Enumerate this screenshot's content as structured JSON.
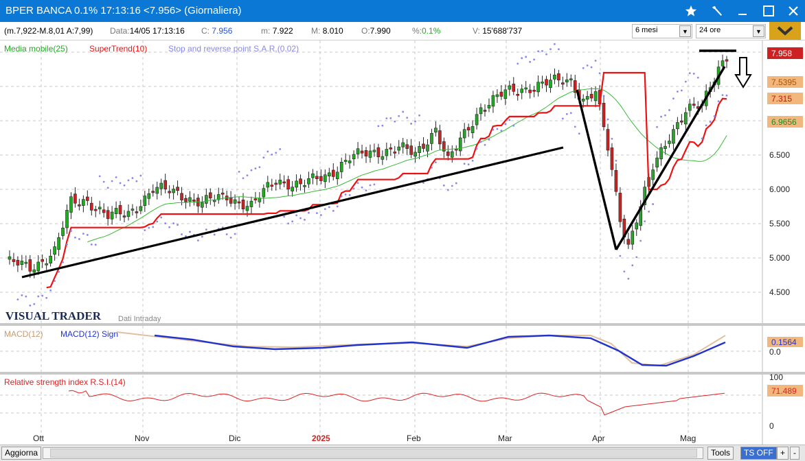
{
  "window": {
    "title": "BPER BANCA 0.1% 17:13:16  <7.956>  (Giornaliera)"
  },
  "infobar": {
    "range": "(m.7,922-M.8,01 A:7,99)",
    "data_label": "Data:",
    "data_value": "14/05 17:13:16",
    "c_label": "C:",
    "c_value": "7.956",
    "m_label": "m:",
    "m_value": "7.922",
    "M_label": "M:",
    "M_value": "8.010",
    "o_label": "O:",
    "o_value": "7.990",
    "pct_label": "%:",
    "pct_value": "0.1%",
    "v_label": "V:",
    "v_value": "15'688'737",
    "period_select": "6 mesi",
    "interval_select": "24 ore"
  },
  "legend": {
    "ma": "Media mobile(25)",
    "supertrend": "SuperTrend(10)",
    "sar": "Stop and reverse point S.A.R.(0.02)"
  },
  "price_axis": {
    "ticks": [
      "6.500",
      "6.000",
      "5.500",
      "5.000",
      "4.500"
    ],
    "badges": [
      {
        "text": "7.958",
        "bg": "#cc2222",
        "fg": "#ffffff"
      },
      {
        "text": "7.5395",
        "bg": "#f2b77d",
        "fg": "#aa5500"
      },
      {
        "text": "7.315",
        "bg": "#f2b77d",
        "fg": "#cc1111"
      },
      {
        "text": "6.9656",
        "bg": "#f2b77d",
        "fg": "#228822"
      }
    ]
  },
  "watermark": {
    "brand": "VISUAL TRADER",
    "sub": "Dati Intraday"
  },
  "macd": {
    "label1": "MACD(12)",
    "label2": "MACD(12) Sign",
    "badge": "0.1564",
    "zero": "0.0"
  },
  "rsi": {
    "label": "Relative strength index R.S.I.(14)",
    "badge": "71.489",
    "top": "100",
    "bottom": "0"
  },
  "x_axis": {
    "labels": [
      "Ott",
      "Nov",
      "Dic",
      "2025",
      "Feb",
      "Mar",
      "Apr",
      "Mag"
    ]
  },
  "bottombar": {
    "update": "Aggiorna",
    "tools": "Tools",
    "ts": "TS OFF",
    "plus": "+",
    "minus": "-"
  },
  "colors": {
    "titlebar": "#0a78d4",
    "up": "#22aa22",
    "down": "#cc2222",
    "supertrend": "#ee1111",
    "ma": "#33bb33",
    "sar": "#8888ee",
    "macd": "#2233cc",
    "rsi": "#dd2222"
  }
}
